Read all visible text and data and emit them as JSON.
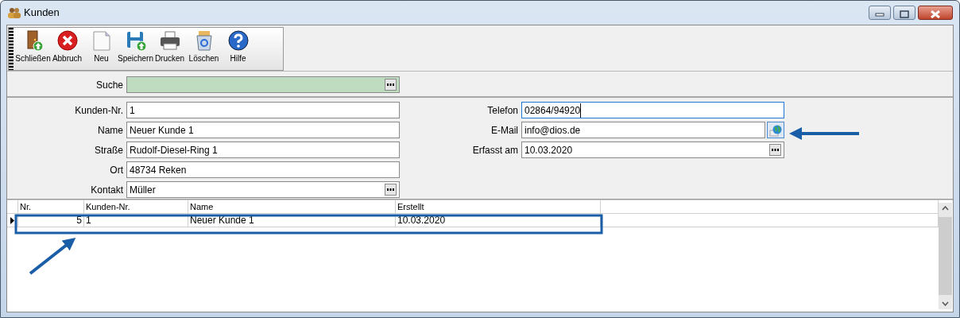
{
  "window": {
    "title": "Kunden"
  },
  "toolbar": {
    "buttons": [
      {
        "label": "Schließen",
        "kind": "close"
      },
      {
        "label": "Abbruch",
        "kind": "cancel"
      },
      {
        "label": "Neu",
        "kind": "new"
      },
      {
        "label": "Speichern",
        "kind": "save"
      },
      {
        "label": "Drucken",
        "kind": "print"
      },
      {
        "label": "Löschen",
        "kind": "delete"
      },
      {
        "label": "Hilfe",
        "kind": "help"
      }
    ]
  },
  "search": {
    "label": "Suche"
  },
  "form_left": [
    {
      "label": "Kunden-Nr.",
      "value": "1",
      "kind": "text"
    },
    {
      "label": "Name",
      "value": "Neuer Kunde 1",
      "kind": "text"
    },
    {
      "label": "Straße",
      "value": "Rudolf-Diesel-Ring 1",
      "kind": "text"
    },
    {
      "label": "Ort",
      "value": "48734 Reken",
      "kind": "text"
    },
    {
      "label": "Kontakt",
      "value": "Müller",
      "kind": "lookup"
    }
  ],
  "form_right": [
    {
      "label": "Telefon",
      "value": "02864/94920",
      "kind": "text",
      "focused": true
    },
    {
      "label": "E-Mail",
      "value": "info@dios.de",
      "kind": "email",
      "focused": false
    },
    {
      "label": "Erfasst am",
      "value": "10.03.2020",
      "kind": "lookup",
      "focused": false
    }
  ],
  "grid": {
    "columns": [
      "Nr.",
      "Kunden-Nr.",
      "Name",
      "Erstellt"
    ],
    "rows": [
      {
        "cells": [
          "5",
          "1",
          "Neuer Kunde 1",
          "10.03.2020"
        ],
        "selected": true
      }
    ]
  }
}
